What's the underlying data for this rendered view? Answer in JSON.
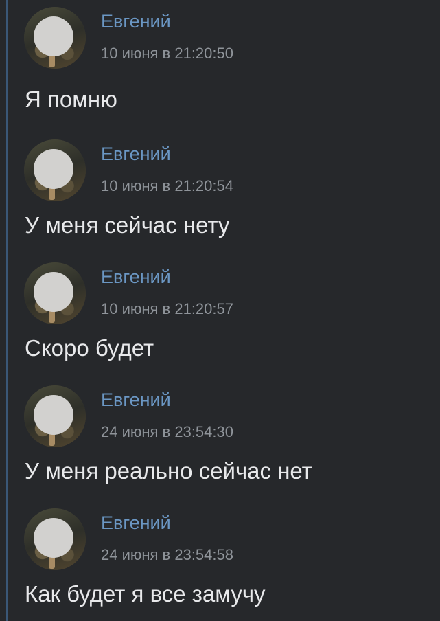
{
  "messages": [
    {
      "author": "Евгений",
      "timestamp": "10 июня в 21:20:50",
      "text": "Я помню"
    },
    {
      "author": "Евгений",
      "timestamp": "10 июня в 21:20:54",
      "text": "У меня сейчас нету"
    },
    {
      "author": "Евгений",
      "timestamp": "10 июня в 21:20:57",
      "text": "Скоро будет"
    },
    {
      "author": "Евгений",
      "timestamp": "24 июня в 23:54:30",
      "text": "У меня реально сейчас нет"
    },
    {
      "author": "Евгений",
      "timestamp": "24 июня в 23:54:58",
      "text": "Как будет я все замучу"
    }
  ],
  "colors": {
    "background": "#26282b",
    "author": "#6b97c4",
    "timestamp": "#8f949a",
    "text": "#e8e9eb",
    "thread_rule": "#3a5777"
  },
  "icons": {
    "avatar": "avatar-photo-blurred"
  }
}
